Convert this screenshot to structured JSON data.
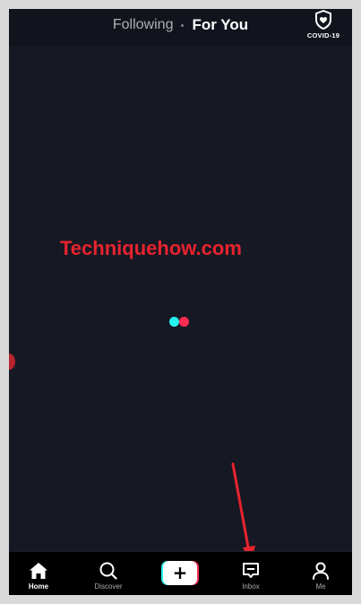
{
  "header": {
    "tabs": [
      {
        "label": "Following",
        "active": false
      },
      {
        "label": "For You",
        "active": true
      }
    ],
    "covid_label": "COVID-19"
  },
  "watermark": "Techniquehow.com",
  "loader": {
    "dot_colors": [
      "#25f4ee",
      "#fe2c55"
    ]
  },
  "bottom_nav": {
    "items": [
      {
        "label": "Home",
        "icon": "home-icon",
        "active": true
      },
      {
        "label": "Discover",
        "icon": "search-icon",
        "active": false
      },
      {
        "label": "+",
        "icon": "plus-icon",
        "active": false
      },
      {
        "label": "Inbox",
        "icon": "inbox-icon",
        "active": false
      },
      {
        "label": "Me",
        "icon": "user-icon",
        "active": false
      }
    ]
  },
  "colors": {
    "background": "#161823",
    "accent_red": "#e8232e",
    "brand_cyan": "#25f4ee",
    "brand_pink": "#fe2c55"
  }
}
